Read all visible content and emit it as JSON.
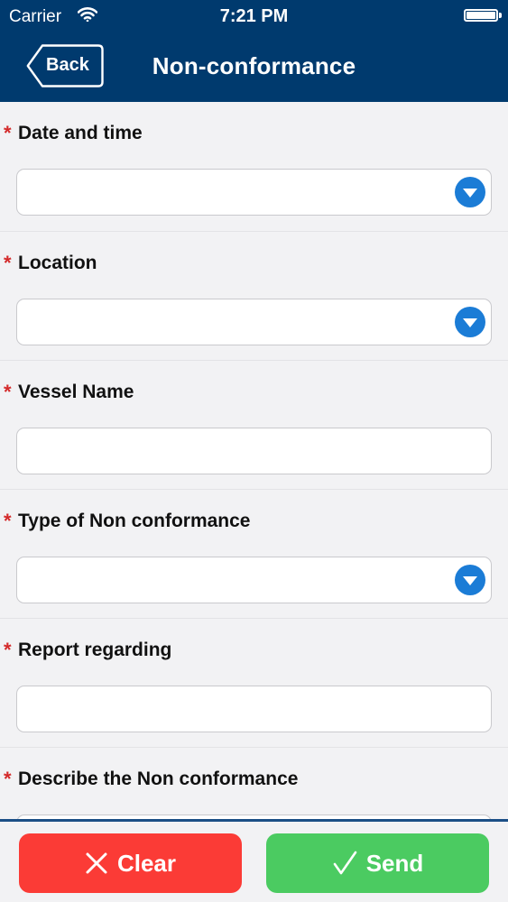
{
  "status_bar": {
    "carrier": "Carrier",
    "time": "7:21 PM"
  },
  "nav": {
    "back_label": "Back",
    "title": "Non-conformance"
  },
  "form": {
    "required_marker": "*",
    "fields": [
      {
        "label": "Date and time",
        "value": "",
        "kind": "dropdown"
      },
      {
        "label": "Location",
        "value": "",
        "kind": "dropdown"
      },
      {
        "label": "Vessel Name",
        "value": "",
        "kind": "text"
      },
      {
        "label": "Type of Non conformance",
        "value": "",
        "kind": "dropdown"
      },
      {
        "label": "Report regarding",
        "value": "",
        "kind": "text"
      },
      {
        "label": "Describe the Non conformance",
        "value": "",
        "kind": "text"
      }
    ]
  },
  "footer": {
    "clear_label": "Clear",
    "send_label": "Send"
  },
  "colors": {
    "header": "#003a6e",
    "clear": "#fb3b36",
    "send": "#4bcb61",
    "dropdown_icon": "#1b7cd6",
    "required": "#d42a2a"
  },
  "icons": {
    "dropdown": "chevron-down-circle-icon",
    "clear": "x-icon",
    "send": "checkmark-icon",
    "back": "back-chevron-icon"
  }
}
